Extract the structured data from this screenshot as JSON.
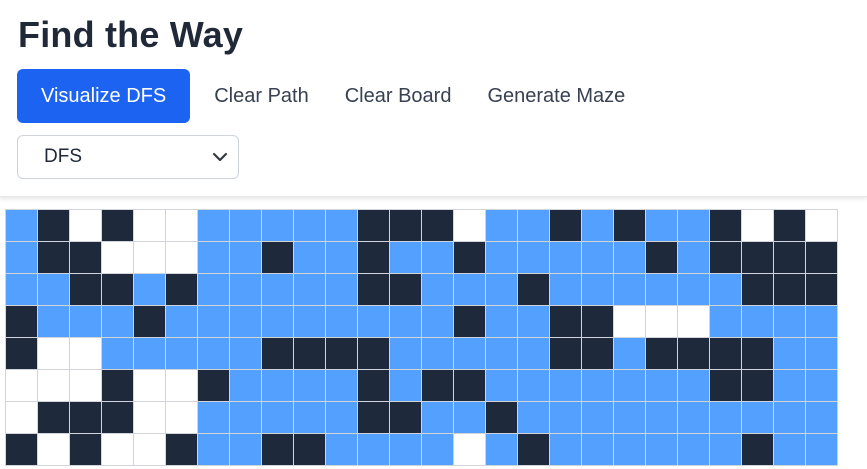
{
  "header": {
    "title": "Find the Way",
    "buttons": {
      "visualize": "Visualize DFS",
      "clear_path": "Clear Path",
      "clear_board": "Clear Board",
      "generate_maze": "Generate Maze"
    },
    "algorithm_select": {
      "value": "DFS",
      "icon": "chevron-down-icon"
    }
  },
  "colors": {
    "primary": "#1d63f2",
    "wall": "#1e293b",
    "visited": "#54a0ff",
    "empty": "#ffffff",
    "grid_line": "#d1d5db"
  },
  "grid": {
    "legend": {
      "W": "wall",
      "V": "visited",
      ".": "empty"
    },
    "rows": [
      "VW.W..VVVVVWWW.VVWVWVVW.W.",
      "VWW...VVWVVWVVWVVVVVWVWWWW",
      "VVWWVWVVVVVWWVVVWVVVVVVWWW",
      "WVVVWVVVVVVVVVWVVWW...VVVV",
      "W..VVVVVWWWWVVVVVWWVWWWWVV",
      "...W..WVVVVWVWWVVVVVVVWWVV",
      ".WWW..VVVVVWWVVWVVVVVVVVVV",
      "W.W..WVVWWVVVV.VWVVVVVVWVV"
    ]
  }
}
